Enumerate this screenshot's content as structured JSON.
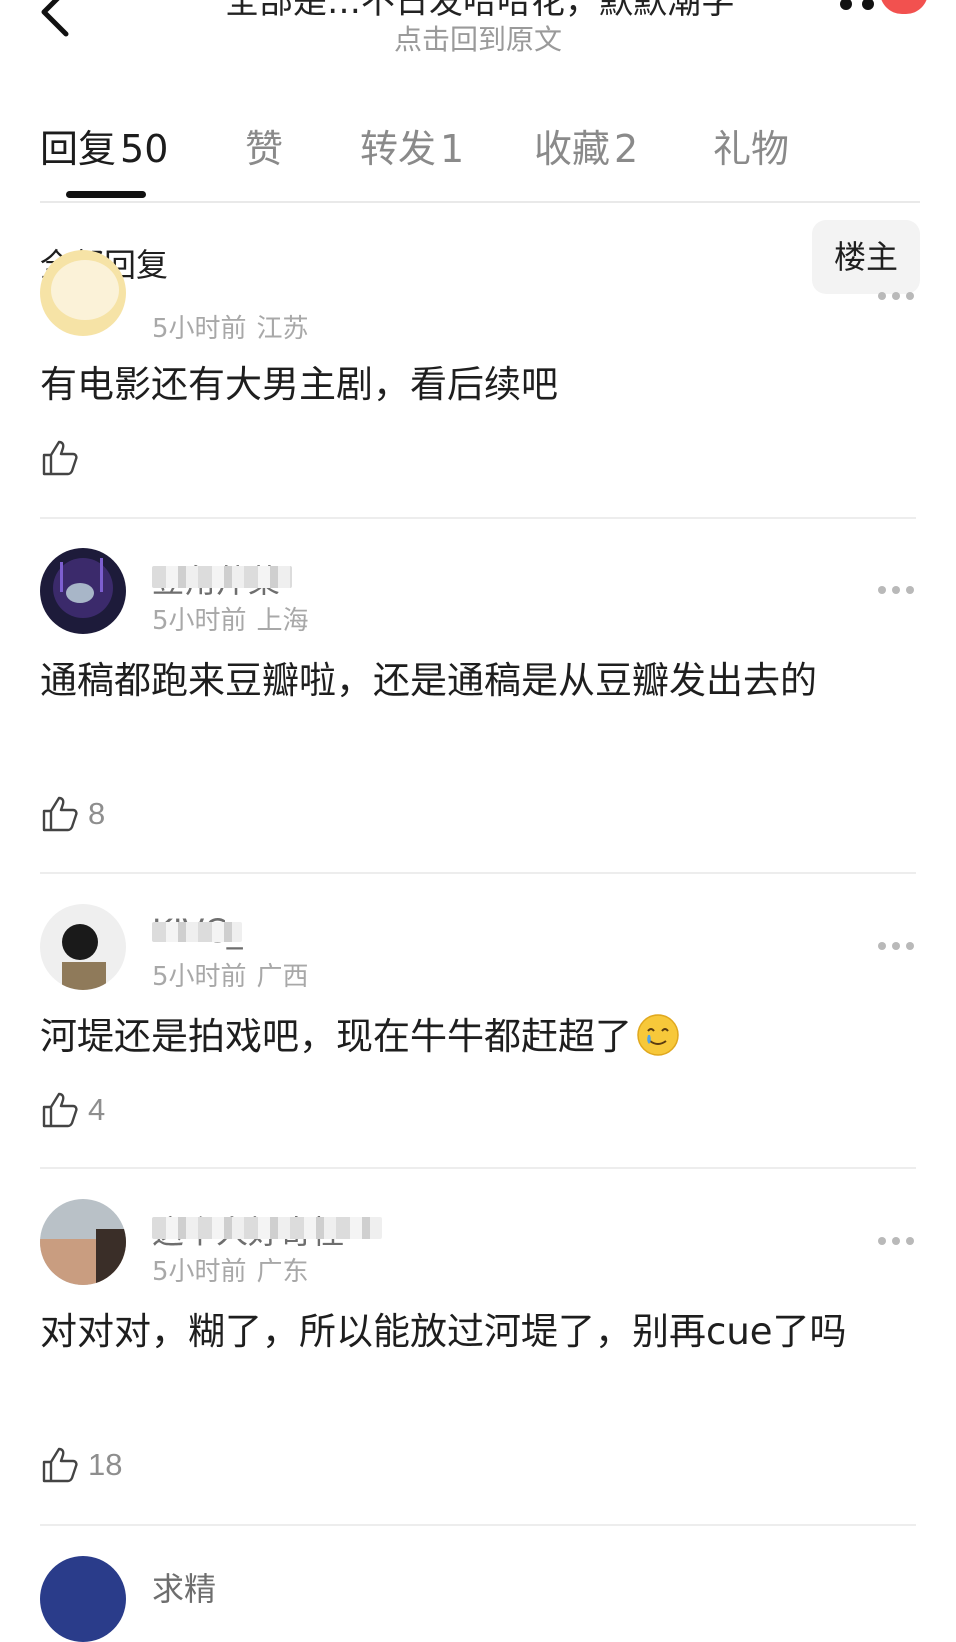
{
  "header": {
    "title_partial": "全部是…不日发哈哈花，默默潮字",
    "back_to_post": "点击回到原文"
  },
  "tabs": [
    {
      "label": "回复",
      "count": "50",
      "active": true
    },
    {
      "label": "赞",
      "count": "",
      "active": false
    },
    {
      "label": "转发",
      "count": "1",
      "active": false
    },
    {
      "label": "收藏",
      "count": "2",
      "active": false
    },
    {
      "label": "礼物",
      "count": "",
      "active": false
    }
  ],
  "filter": {
    "label": "全部回复",
    "owner_button": "楼主"
  },
  "comments": [
    {
      "username": "",
      "time": "5小时前",
      "location": "江苏",
      "text": "有电影还有大男主剧，看后续吧",
      "likes": ""
    },
    {
      "username": "豆角芹菜",
      "time": "5小时前",
      "location": "上海",
      "text": "通稿都跑来豆瓣啦，还是通稿是从豆瓣发出去的",
      "likes": "8"
    },
    {
      "username": "KIVC_",
      "time": "5小时前",
      "location": "广西",
      "text": "河堤还是拍戏吧，现在牛牛都赶超了",
      "likes": "4"
    },
    {
      "username": "这个人好奇怪",
      "time": "5小时前",
      "location": "广东",
      "text": "对对对，糊了，所以能放过河堤了，别再cue了吗",
      "likes": "18"
    },
    {
      "username": "求精",
      "time": "",
      "location": "",
      "text": "",
      "likes": ""
    }
  ],
  "icons": {
    "back": "chevron-left-icon",
    "more": "more-dots-icon",
    "like": "thumbs-up-icon",
    "emoji": "tearful-smile-emoji"
  },
  "colors": {
    "badge": "#f2514f",
    "muted": "#a8a8a8",
    "text": "#1e1e1e"
  }
}
